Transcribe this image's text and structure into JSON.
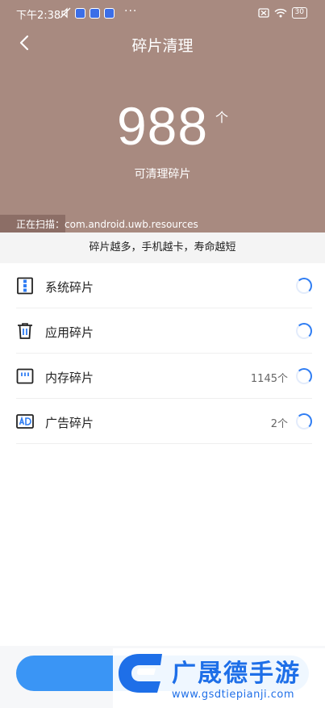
{
  "status_bar": {
    "time": "下午2:38",
    "dots": "···",
    "battery": "30"
  },
  "header": {
    "title": "碎片清理"
  },
  "summary": {
    "count": "988",
    "unit": "个",
    "label": "可清理碎片"
  },
  "scan": {
    "text": "正在扫描：com.android.uwb.resources",
    "progress_percent": 20
  },
  "tip": "碎片越多，手机越卡，寿命越短",
  "items": [
    {
      "label": "系统碎片",
      "count": "",
      "icon": "system-fragment-icon"
    },
    {
      "label": "应用碎片",
      "count": "",
      "icon": "trash-icon"
    },
    {
      "label": "内存碎片",
      "count": "1145个",
      "icon": "memory-card-icon"
    },
    {
      "label": "广告碎片",
      "count": "2个",
      "icon": "ad-icon"
    }
  ],
  "watermark": {
    "brand": "广晟德手游",
    "url": "www.gsdtiepianji.com"
  },
  "colors": {
    "hero": "#a88a80",
    "accent": "#2f7df3",
    "button": "#3a95f5"
  }
}
